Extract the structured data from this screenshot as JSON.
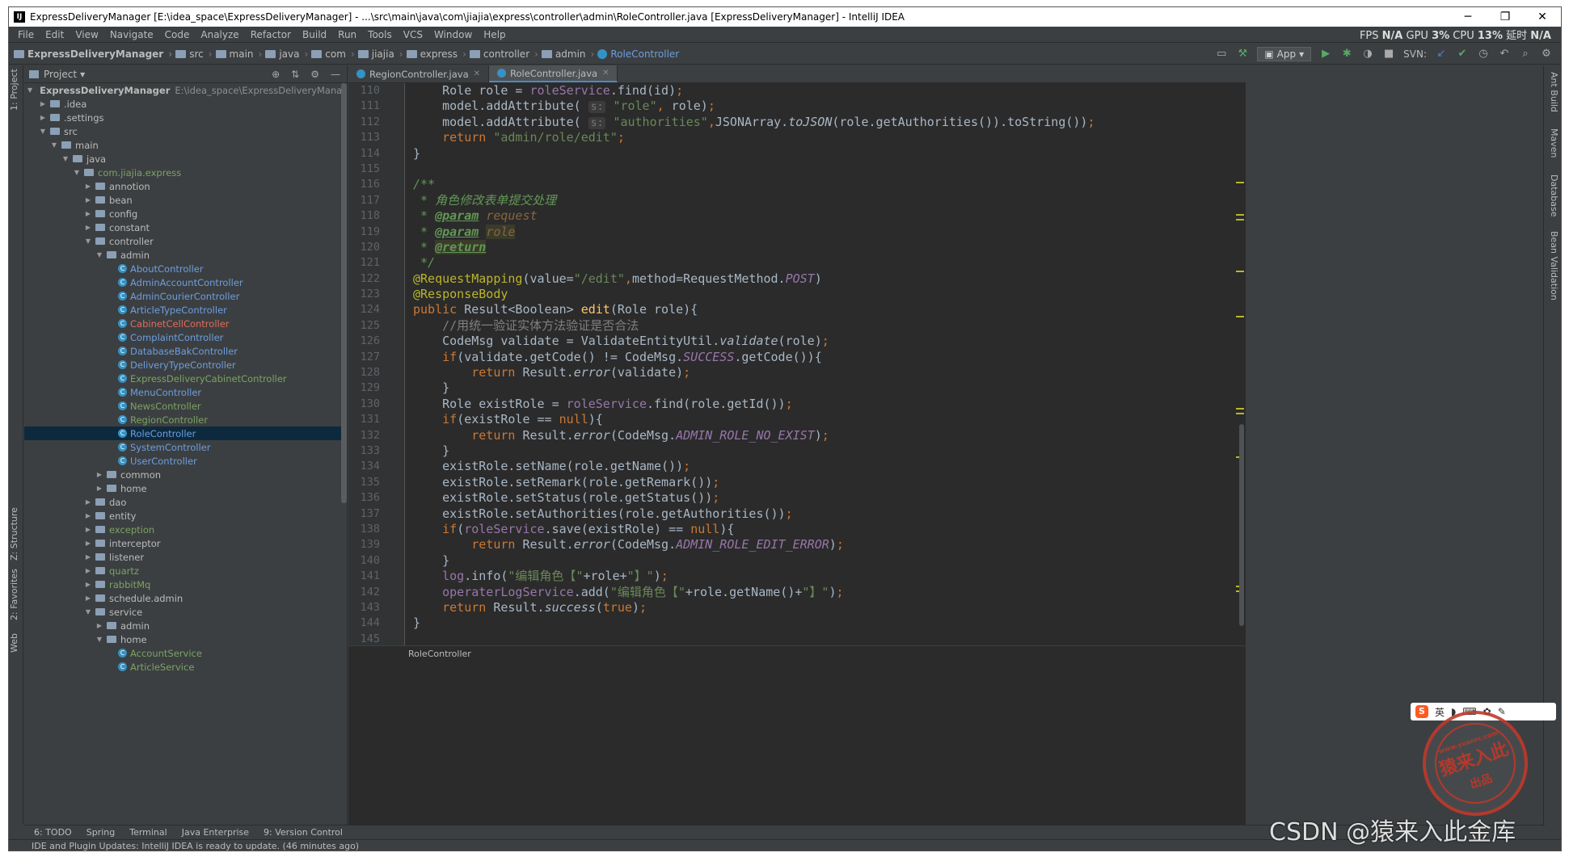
{
  "window": {
    "title": "ExpressDeliveryManager [E:\\idea_space\\ExpressDeliveryManager] - ...\\src\\main\\java\\com\\jiajia\\express\\controller\\admin\\RoleController.java [ExpressDeliveryManager] - IntelliJ IDEA",
    "minimize": "─",
    "maximize": "❐",
    "close": "✕"
  },
  "menu": [
    "File",
    "Edit",
    "View",
    "Navigate",
    "Code",
    "Analyze",
    "Refactor",
    "Build",
    "Run",
    "Tools",
    "VCS",
    "Window",
    "Help"
  ],
  "perf": {
    "fps_label": "FPS",
    "fps_value": "N/A",
    "gpu_label": "GPU",
    "gpu_value": "3%",
    "cpu_label": "CPU",
    "cpu_value": "13%",
    "delay_label": "延时",
    "delay_value": "N/A"
  },
  "breadcrumbs": [
    "ExpressDeliveryManager",
    "src",
    "main",
    "java",
    "com",
    "jiajia",
    "express",
    "controller",
    "admin",
    "RoleController"
  ],
  "run_config": "App",
  "svn_label": "SVN:",
  "left_stripe": {
    "project": "1: Project",
    "structure": "Z: Structure",
    "favorites": "2: Favorites",
    "web": "Web"
  },
  "right_stripe": {
    "ant": "Ant Build",
    "maven": "Maven",
    "database": "Database",
    "bean": "Bean Validation"
  },
  "project_panel": {
    "title": "Project",
    "root_name": "ExpressDeliveryManager",
    "root_path": "E:\\idea_space\\ExpressDeliveryManager",
    "rows": [
      {
        "indent": 1,
        "arrow": "▶",
        "label": ".idea",
        "color": "normal"
      },
      {
        "indent": 1,
        "arrow": "▶",
        "label": ".settings",
        "color": "normal"
      },
      {
        "indent": 1,
        "arrow": "▼",
        "label": "src",
        "color": "normal"
      },
      {
        "indent": 2,
        "arrow": "▼",
        "label": "main",
        "color": "normal"
      },
      {
        "indent": 3,
        "arrow": "▼",
        "label": "java",
        "color": "normal"
      },
      {
        "indent": 4,
        "arrow": "▼",
        "label": "com.jiajia.express",
        "color": "green"
      },
      {
        "indent": 5,
        "arrow": "▶",
        "label": "annotion",
        "color": "normal"
      },
      {
        "indent": 5,
        "arrow": "▶",
        "label": "bean",
        "color": "normal"
      },
      {
        "indent": 5,
        "arrow": "▶",
        "label": "config",
        "color": "normal"
      },
      {
        "indent": 5,
        "arrow": "▶",
        "label": "constant",
        "color": "normal"
      },
      {
        "indent": 5,
        "arrow": "▼",
        "label": "controller",
        "color": "normal"
      },
      {
        "indent": 6,
        "arrow": "▼",
        "label": "admin",
        "color": "normal"
      },
      {
        "indent": 7,
        "arrow": "",
        "label": "AboutController",
        "color": "blue",
        "cls": true
      },
      {
        "indent": 7,
        "arrow": "",
        "label": "AdminAccountController",
        "color": "blue",
        "cls": true
      },
      {
        "indent": 7,
        "arrow": "",
        "label": "AdminCourierController",
        "color": "blue",
        "cls": true
      },
      {
        "indent": 7,
        "arrow": "",
        "label": "ArticleTypeController",
        "color": "blue",
        "cls": true
      },
      {
        "indent": 7,
        "arrow": "",
        "label": "CabinetCellController",
        "color": "red",
        "cls": true
      },
      {
        "indent": 7,
        "arrow": "",
        "label": "ComplaintController",
        "color": "blue",
        "cls": true
      },
      {
        "indent": 7,
        "arrow": "",
        "label": "DatabaseBakController",
        "color": "blue",
        "cls": true
      },
      {
        "indent": 7,
        "arrow": "",
        "label": "DeliveryTypeController",
        "color": "blue",
        "cls": true
      },
      {
        "indent": 7,
        "arrow": "",
        "label": "ExpressDeliveryCabinetController",
        "color": "green",
        "cls": true
      },
      {
        "indent": 7,
        "arrow": "",
        "label": "MenuController",
        "color": "blue",
        "cls": true
      },
      {
        "indent": 7,
        "arrow": "",
        "label": "NewsController",
        "color": "green",
        "cls": true
      },
      {
        "indent": 7,
        "arrow": "",
        "label": "RegionController",
        "color": "green",
        "cls": true
      },
      {
        "indent": 7,
        "arrow": "",
        "label": "RoleController",
        "color": "blue",
        "cls": true,
        "selected": true
      },
      {
        "indent": 7,
        "arrow": "",
        "label": "SystemController",
        "color": "blue",
        "cls": true
      },
      {
        "indent": 7,
        "arrow": "",
        "label": "UserController",
        "color": "blue",
        "cls": true
      },
      {
        "indent": 6,
        "arrow": "▶",
        "label": "common",
        "color": "normal"
      },
      {
        "indent": 6,
        "arrow": "▶",
        "label": "home",
        "color": "normal"
      },
      {
        "indent": 5,
        "arrow": "▶",
        "label": "dao",
        "color": "normal"
      },
      {
        "indent": 5,
        "arrow": "▶",
        "label": "entity",
        "color": "normal"
      },
      {
        "indent": 5,
        "arrow": "▶",
        "label": "exception",
        "color": "green"
      },
      {
        "indent": 5,
        "arrow": "▶",
        "label": "interceptor",
        "color": "normal"
      },
      {
        "indent": 5,
        "arrow": "▶",
        "label": "listener",
        "color": "normal"
      },
      {
        "indent": 5,
        "arrow": "▶",
        "label": "quartz",
        "color": "green"
      },
      {
        "indent": 5,
        "arrow": "▶",
        "label": "rabbitMq",
        "color": "green"
      },
      {
        "indent": 5,
        "arrow": "▶",
        "label": "schedule.admin",
        "color": "normal"
      },
      {
        "indent": 5,
        "arrow": "▼",
        "label": "service",
        "color": "normal"
      },
      {
        "indent": 6,
        "arrow": "▶",
        "label": "admin",
        "color": "normal"
      },
      {
        "indent": 6,
        "arrow": "▼",
        "label": "home",
        "color": "normal"
      },
      {
        "indent": 7,
        "arrow": "",
        "label": "AccountService",
        "color": "green",
        "cls": true
      },
      {
        "indent": 7,
        "arrow": "",
        "label": "ArticleService",
        "color": "green",
        "cls": true
      }
    ]
  },
  "editor": {
    "tabs": [
      {
        "label": "RegionController.java",
        "active": false
      },
      {
        "label": "RoleController.java",
        "active": true
      }
    ],
    "first_line": 110,
    "bottom_breadcrumb": "RoleController"
  },
  "bottom_tabs": [
    "6: TODO",
    "Spring",
    "Terminal",
    "Java Enterprise",
    "9: Version Control"
  ],
  "status": "IDE and Plugin Updates: IntelliJ IDEA is ready to update. (46 minutes ago)",
  "watermark": {
    "stamp_text": "猿来入此",
    "stamp_sub": "出品",
    "stamp_url": "www.yuanrc.com",
    "csdn": "CSDN @猿来入此金库"
  },
  "ime": {
    "logo": "S",
    "lang": "英"
  }
}
